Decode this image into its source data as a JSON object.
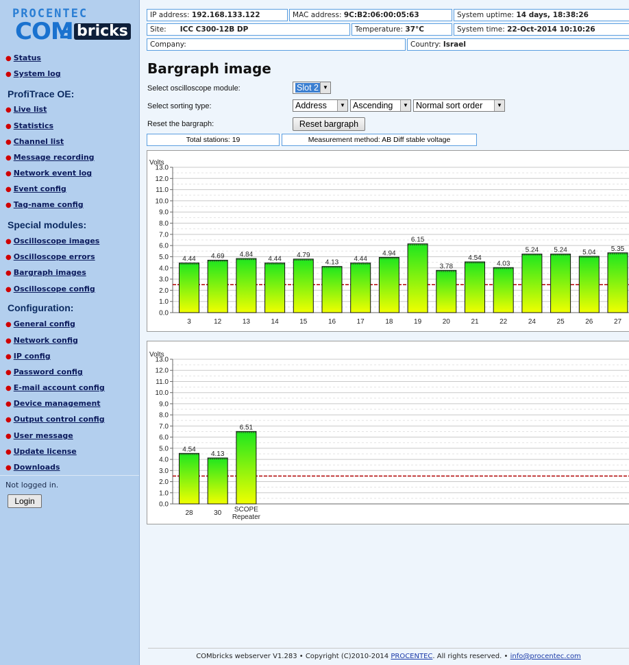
{
  "logo": {
    "top": "PROCENTEC",
    "com": "COM",
    "bricks": "bricks"
  },
  "sidebar": {
    "top_items": [
      {
        "label": "Status"
      },
      {
        "label": "System log"
      }
    ],
    "sections": [
      {
        "title": "ProfiTrace OE:",
        "items": [
          {
            "label": "Live list"
          },
          {
            "label": "Statistics"
          },
          {
            "label": "Channel list"
          },
          {
            "label": "Message recording"
          },
          {
            "label": "Network event log"
          },
          {
            "label": "Event config"
          },
          {
            "label": "Tag-name config"
          }
        ]
      },
      {
        "title": "Special modules:",
        "items": [
          {
            "label": "Oscilloscope images"
          },
          {
            "label": "Oscilloscope errors"
          },
          {
            "label": "Bargraph images"
          },
          {
            "label": "Oscilloscope config"
          }
        ]
      },
      {
        "title": "Configuration:",
        "items": [
          {
            "label": "General config"
          },
          {
            "label": "Network config"
          },
          {
            "label": "IP config"
          },
          {
            "label": "Password config"
          },
          {
            "label": "E-mail account config"
          },
          {
            "label": "Device management"
          },
          {
            "label": "Output control config"
          },
          {
            "label": "User message"
          },
          {
            "label": "Update license"
          },
          {
            "label": "Downloads"
          }
        ]
      }
    ],
    "login_status": "Not logged in.",
    "login_button": "Login"
  },
  "header": {
    "ip_label": "IP address:",
    "ip_value": "192.168.133.122",
    "mac_label": "MAC address:",
    "mac_value": "9C:B2:06:00:05:63",
    "uptime_label": "System uptime:",
    "uptime_value": "14 days, 18:38:26",
    "site_label": "Site:",
    "site_value": "ICC C300-12B DP",
    "temp_label": "Temperature:",
    "temp_value": "37°C",
    "time_label": "System time:",
    "time_value": "22-Oct-2014 10:10:26",
    "company_label": "Company:",
    "company_value": "",
    "country_label": "Country:",
    "country_value": "Israel"
  },
  "page": {
    "title": "Bargraph image",
    "module_label": "Select oscilloscope module:",
    "module_value": "Slot 2",
    "sort_label": "Select sorting type:",
    "sort_field": "Address",
    "sort_dir": "Ascending",
    "sort_order": "Normal sort order",
    "reset_label": "Reset the bargraph:",
    "reset_button": "Reset bargraph",
    "total_stations": "Total stations: 19",
    "measurement": "Measurement method: AB Diff stable voltage"
  },
  "chart_data": [
    {
      "type": "bar",
      "ylabel": "Volts",
      "ylim": [
        0,
        13
      ],
      "threshold": 2.5,
      "categories": [
        "3",
        "12",
        "13",
        "14",
        "15",
        "16",
        "17",
        "18",
        "19",
        "20",
        "21",
        "22",
        "24",
        "25",
        "26",
        "27"
      ],
      "values": [
        4.44,
        4.69,
        4.84,
        4.44,
        4.79,
        4.13,
        4.44,
        4.94,
        6.15,
        3.78,
        4.54,
        4.03,
        5.24,
        5.24,
        5.04,
        5.35
      ],
      "labels": [
        "4.44",
        "4.69",
        "4.84",
        "4.44",
        "4.79",
        "4.13",
        "4.44",
        "4.94",
        "6.15",
        "3.78",
        "4.54",
        "4.03",
        "5.24",
        "5.24",
        "5.04",
        "5.35"
      ]
    },
    {
      "type": "bar",
      "ylabel": "Volts",
      "ylim": [
        0,
        13
      ],
      "threshold": 2.5,
      "categories": [
        "28",
        "30",
        "SCOPE Repeater"
      ],
      "values": [
        4.54,
        4.13,
        6.51
      ],
      "labels": [
        "4.54",
        "4.13",
        "6.51"
      ]
    }
  ],
  "footer": {
    "text": "COMbricks webserver V1.283 • Copyright (C)2010-2014 ",
    "link": "PROCENTEC",
    "text2": ". All rights reserved. • ",
    "email": "info@procentec.com"
  },
  "colors": {
    "sidebar": "#b3cfee",
    "link": "#0b1a5c",
    "cell_border": "#5a9ee0",
    "bar_top": "#1ee61e",
    "bar_bottom": "#f0ff00",
    "threshold": "#b00000"
  }
}
